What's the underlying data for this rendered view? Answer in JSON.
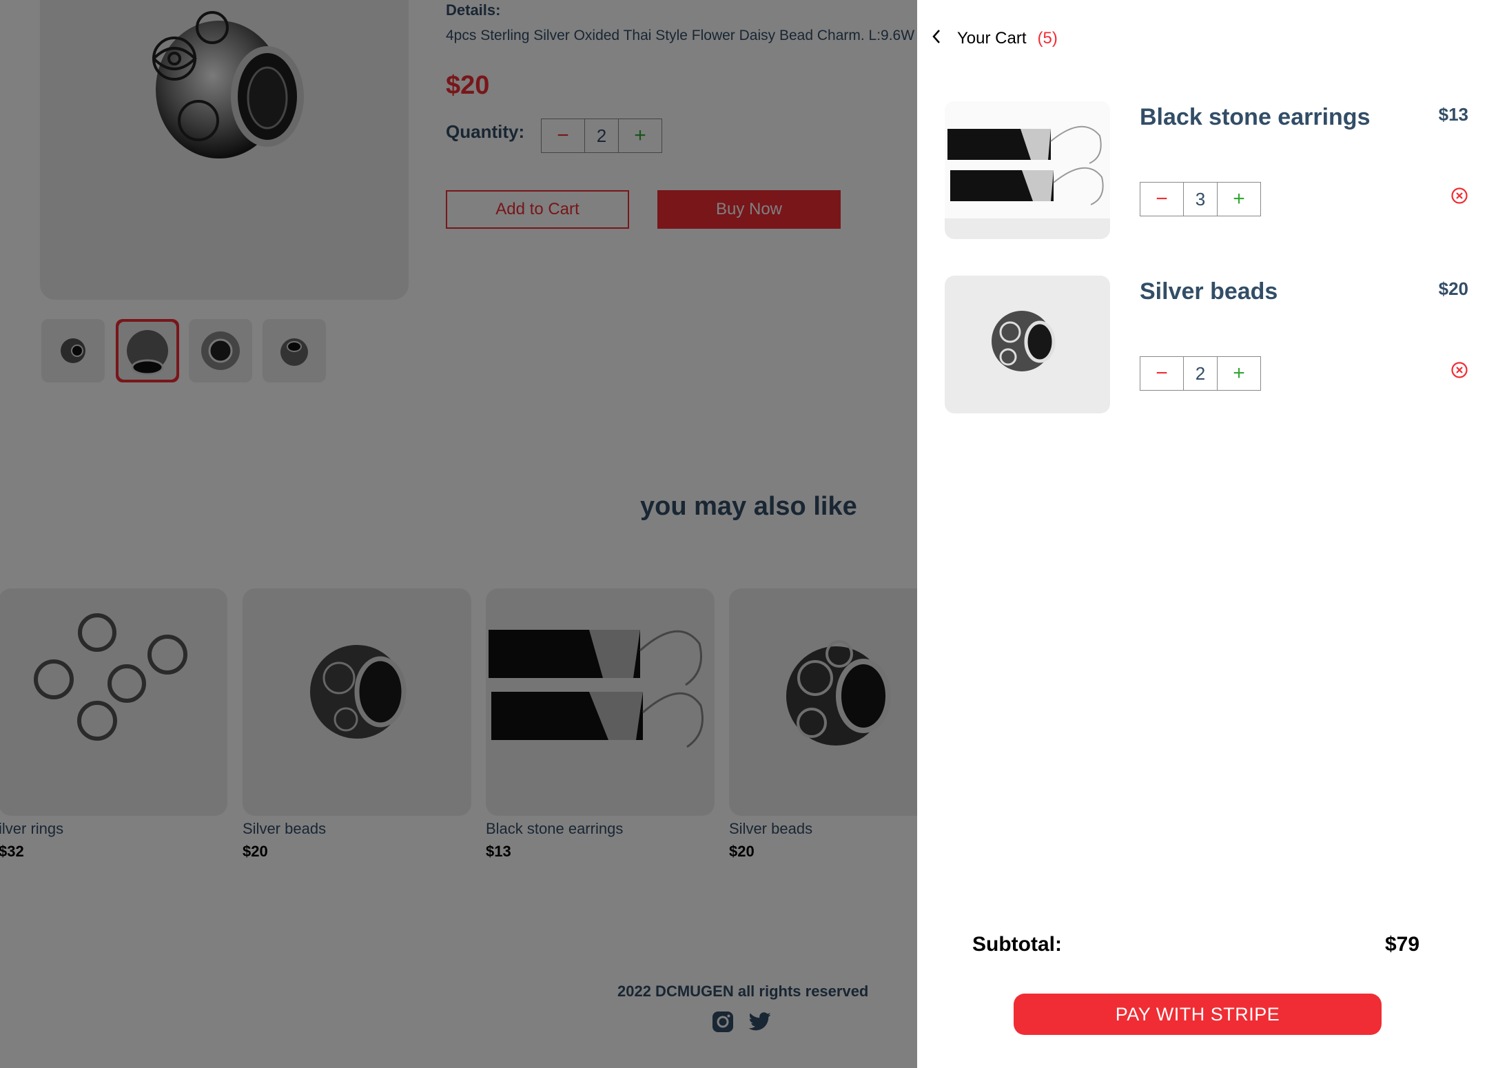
{
  "product": {
    "details_label": "Details:",
    "details_text": "4pcs Sterling Silver Oxided Thai Style Flower Daisy Bead Charm. L:9.6W",
    "price": "$20",
    "quantity_label": "Quantity:",
    "quantity": "2",
    "add_to_cart_label": "Add to Cart",
    "buy_now_label": "Buy Now"
  },
  "recommendations": {
    "title": "you may also like",
    "items": [
      {
        "name": "ilver rings",
        "price": "$32"
      },
      {
        "name": "Silver beads",
        "price": "$20"
      },
      {
        "name": "Black stone earrings",
        "price": "$13"
      },
      {
        "name": "Silver beads",
        "price": "$20"
      }
    ]
  },
  "footer": {
    "text": "2022 DCMUGEN all rights reserved",
    "icons": [
      "instagram-icon",
      "twitter-icon"
    ]
  },
  "cart": {
    "title": "Your Cart",
    "count": "(5)",
    "items": [
      {
        "name": "Black stone earrings",
        "price": "$13",
        "quantity": "3"
      },
      {
        "name": "Silver beads",
        "price": "$20",
        "quantity": "2"
      }
    ],
    "subtotal_label": "Subtotal:",
    "subtotal_value": "$79",
    "pay_label": "PAY WITH STRIPE"
  },
  "symbols": {
    "minus": "−",
    "plus": "+",
    "back": "<"
  },
  "colors": {
    "accent": "#f02d34",
    "text": "#324d67",
    "plus": "#31a831",
    "overlay": "rgba(0,0,0,0.5)"
  }
}
